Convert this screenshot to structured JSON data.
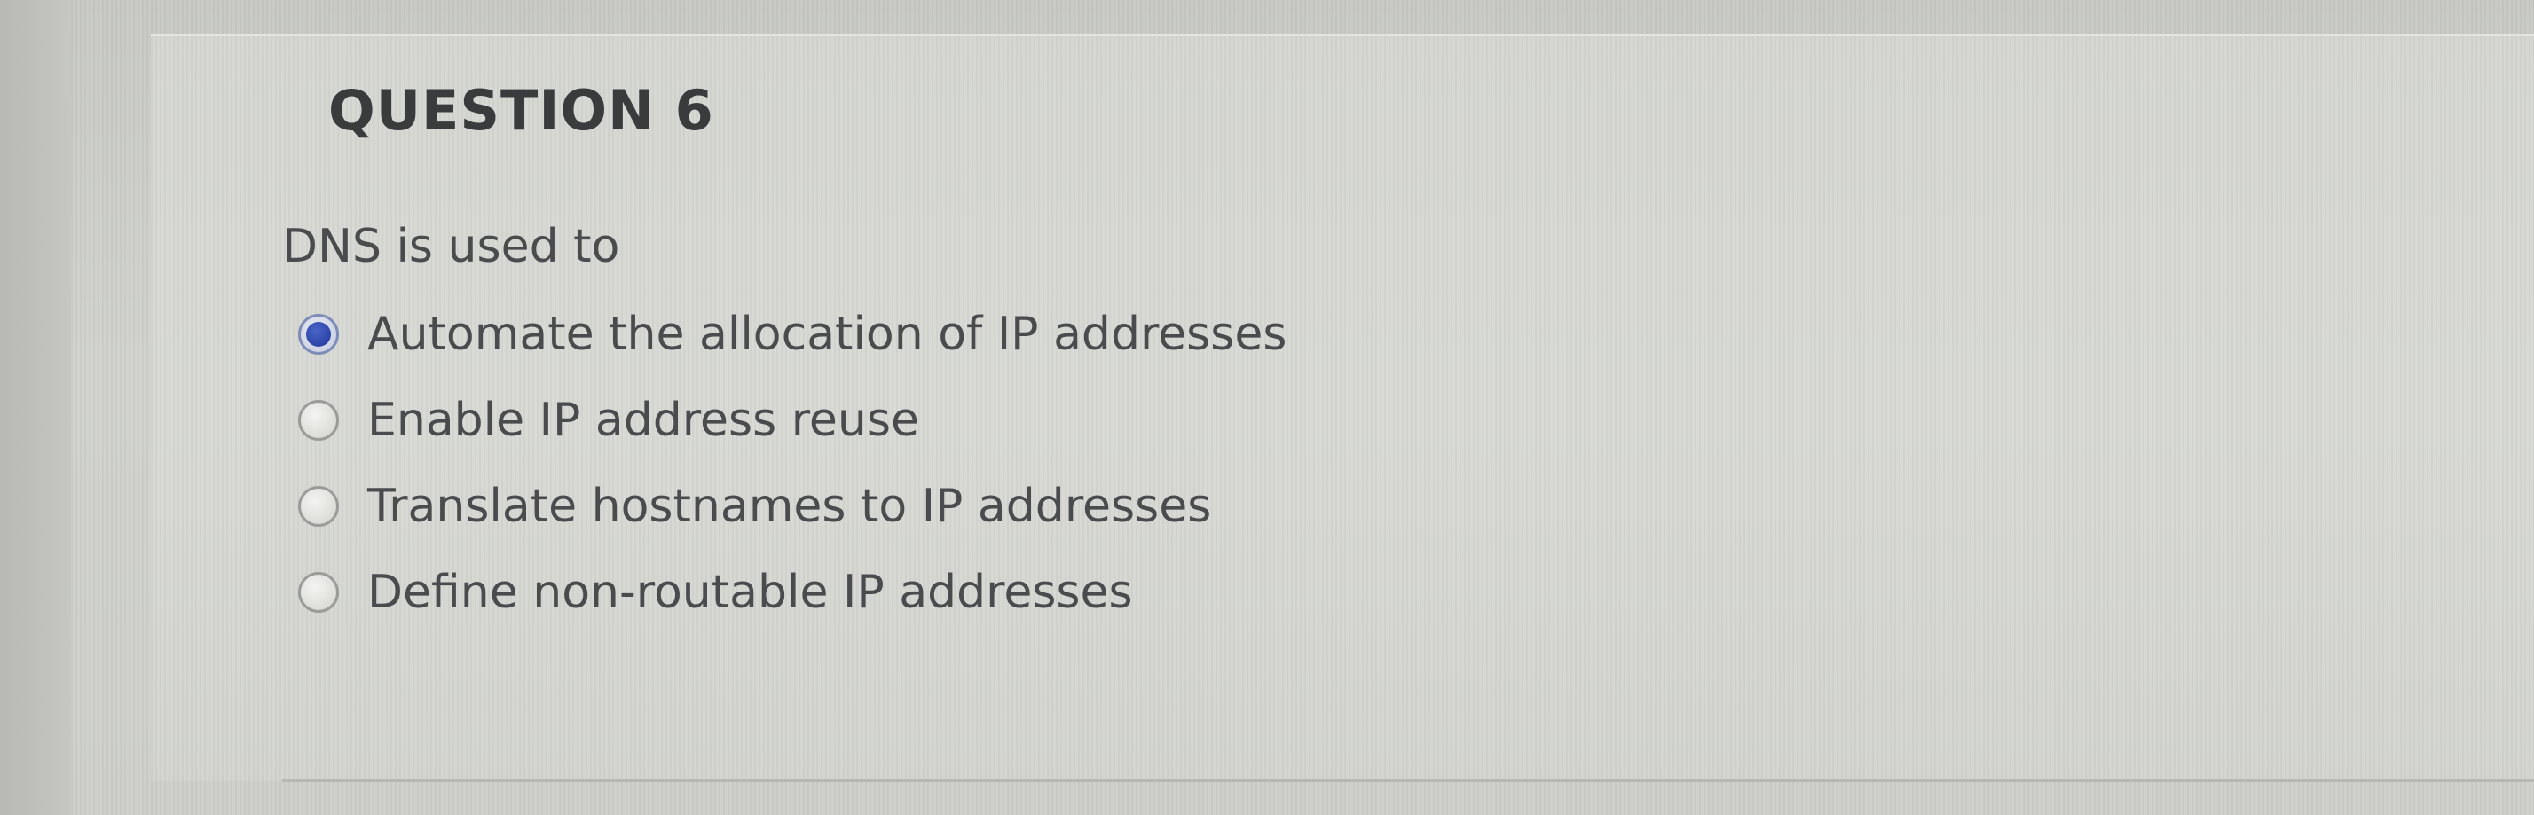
{
  "question": {
    "title": "QUESTION 6",
    "text": "DNS is used to",
    "options": [
      {
        "label": "Automate the allocation of IP addresses",
        "selected": true
      },
      {
        "label": "Enable IP address reuse",
        "selected": false
      },
      {
        "label": "Translate hostnames to IP addresses",
        "selected": false
      },
      {
        "label": "Define non-routable IP addresses",
        "selected": false
      }
    ]
  },
  "colors": {
    "background": "#d2d3cf",
    "text": "#4a4b4d",
    "radio_selected": "#2c44a8"
  }
}
